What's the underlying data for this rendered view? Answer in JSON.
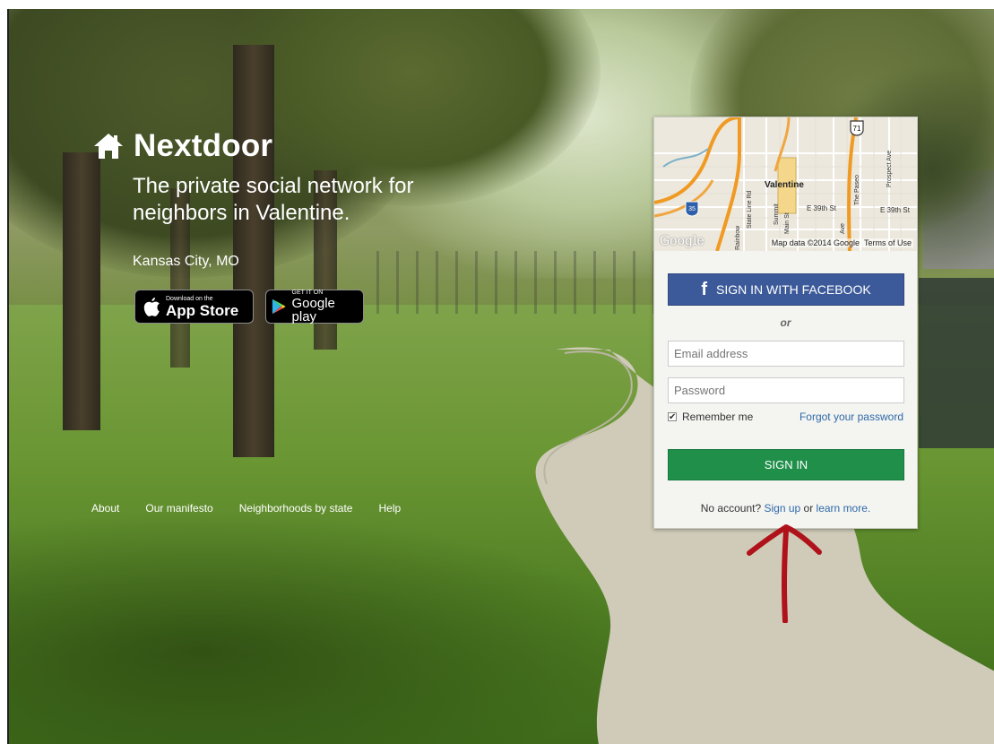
{
  "brand": {
    "name": "Nextdoor",
    "icon": "house-icon"
  },
  "hero": {
    "tagline": "The private social network for neighbors in Valentine.",
    "location": "Kansas City, MO"
  },
  "badges": {
    "appstore": {
      "small": "Download on the",
      "big": "App Store",
      "icon": "apple-icon"
    },
    "googleplay": {
      "small": "GET IT ON",
      "big": "Google play",
      "icon": "play-icon"
    }
  },
  "footer": {
    "links": [
      "About",
      "Our manifesto",
      "Neighborhoods by state",
      "Help"
    ]
  },
  "map": {
    "label": "Valentine",
    "streets": [
      "E 39th St",
      "E 39th St",
      "The Paseo",
      "Prospect Ave",
      "State Line Rd",
      "Rainbow",
      "Ave",
      "Main St",
      "Summit"
    ],
    "shields": [
      "71",
      "35"
    ],
    "credit": "Map data ©2014 Google",
    "terms": "Terms of Use",
    "logo": "Google"
  },
  "login": {
    "facebook_label": "SIGN IN WITH FACEBOOK",
    "facebook_icon": "facebook-icon",
    "or": "or",
    "email_placeholder": "Email address",
    "password_placeholder": "Password",
    "remember_label": "Remember me",
    "remember_checked": true,
    "forgot_label": "Forgot your password",
    "signin_label": "SIGN IN",
    "noaccount_prefix": "No account?",
    "signup_label": "Sign up",
    "or_word": "or",
    "learnmore_label": "learn more."
  },
  "colors": {
    "facebook": "#3c5a99",
    "signin": "#1f8f4a",
    "link": "#2f6aa8",
    "annotation": "#b0121b"
  }
}
